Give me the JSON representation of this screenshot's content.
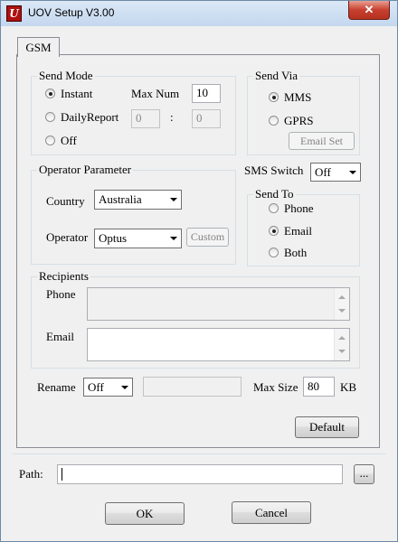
{
  "window": {
    "title": "UOV Setup V3.00",
    "close_glyph": "✕"
  },
  "tabs": [
    {
      "label": "GSM"
    }
  ],
  "send_mode": {
    "legend": "Send Mode",
    "instant": "Instant",
    "daily_report": "DailyReport",
    "off": "Off",
    "selected": "Instant",
    "max_num_label": "Max Num",
    "max_num_value": "10",
    "hour_value": "0",
    "separator": ":",
    "minute_value": "0"
  },
  "send_via": {
    "legend": "Send Via",
    "mms": "MMS",
    "gprs": "GPRS",
    "selected": "MMS",
    "email_set_label": "Email Set"
  },
  "operator_parameter": {
    "legend": "Operator Parameter",
    "country_label": "Country",
    "country_value": "Australia",
    "operator_label": "Operator",
    "operator_value": "Optus",
    "custom_label": "Custom"
  },
  "sms_switch": {
    "label": "SMS Switch",
    "value": "Off"
  },
  "send_to": {
    "legend": "Send To",
    "phone": "Phone",
    "email": "Email",
    "both": "Both",
    "selected": "Email"
  },
  "recipients": {
    "legend": "Recipients",
    "phone_label": "Phone",
    "email_label": "Email",
    "phone_value": "",
    "email_value": ""
  },
  "rename": {
    "label": "Rename",
    "value": "Off",
    "text_value": ""
  },
  "max_size": {
    "label": "Max Size",
    "value": "80",
    "unit": "KB"
  },
  "default_label": "Default",
  "path": {
    "label": "Path:",
    "value": "",
    "browse_label": "..."
  },
  "buttons": {
    "ok": "OK",
    "cancel": "Cancel"
  },
  "icons": {
    "app": "uov-app-icon",
    "close": "close-icon",
    "dropdown": "chevron-down-icon"
  }
}
